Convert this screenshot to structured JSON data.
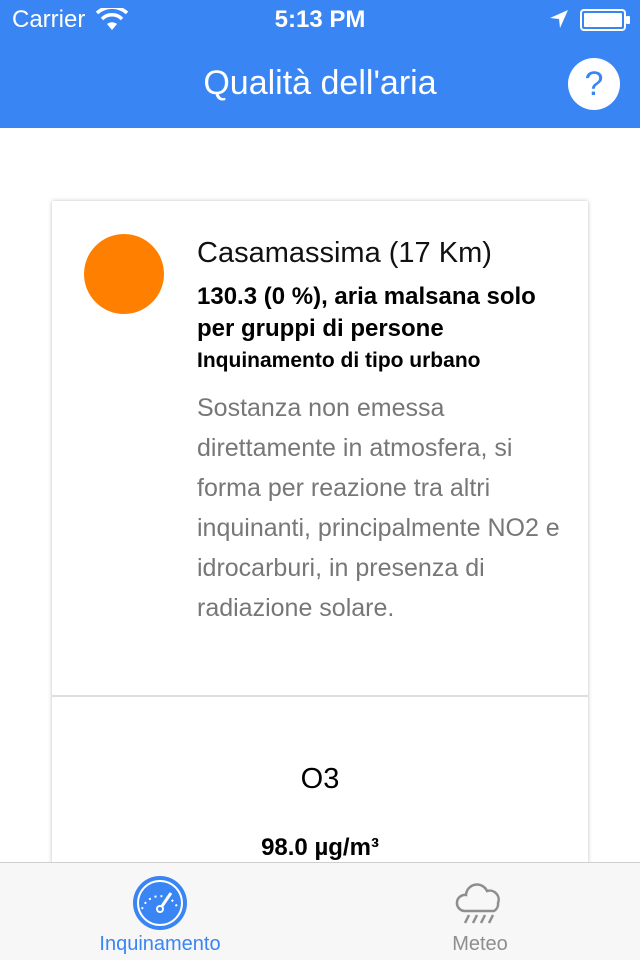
{
  "status_bar": {
    "carrier": "Carrier",
    "time": "5:13 PM"
  },
  "nav": {
    "title": "Qualità dell'aria",
    "help_label": "?"
  },
  "card": {
    "station": "Casamassima (17 Km)",
    "value_summary": "130.3 (0 %), aria malsana solo per gruppi di persone",
    "pollution_type": "Inquinamento di tipo urbano",
    "description": "Sostanza non emessa direttamente in atmosfera, si forma per reazione tra altri inquinanti, principalmente NO2 e idrocarburi, in presenza di radiazione solare.",
    "indicator_color": "#ff8000",
    "pollutant": "O3",
    "concentration": "98.0 µg/m³"
  },
  "tabs": [
    {
      "label": "Inquinamento",
      "icon": "gauge-icon",
      "active": true
    },
    {
      "label": "Meteo",
      "icon": "rain-cloud-icon",
      "active": false
    }
  ],
  "colors": {
    "accent": "#3a85f4",
    "inactive": "#8e8e8e"
  }
}
